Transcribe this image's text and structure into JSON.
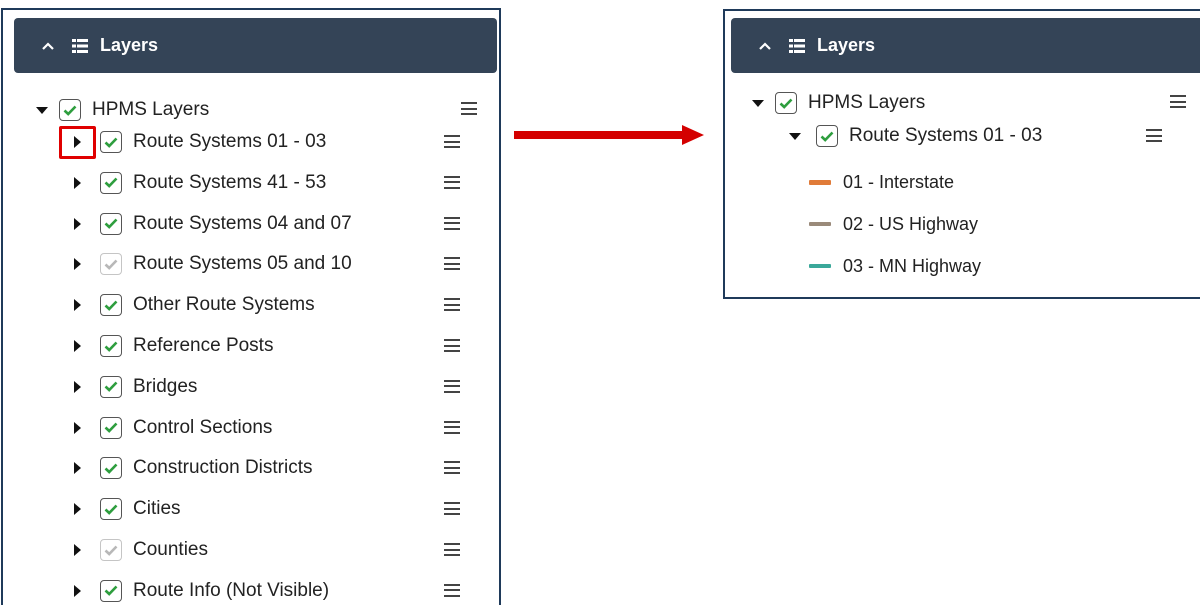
{
  "left_panel": {
    "header": {
      "title": "Layers"
    },
    "root": {
      "label": "HPMS Layers"
    },
    "items": [
      {
        "label": "Route Systems 01 - 03",
        "checked": true,
        "dim": false
      },
      {
        "label": "Route Systems 41 - 53",
        "checked": true,
        "dim": false
      },
      {
        "label": "Route Systems 04 and 07",
        "checked": true,
        "dim": false
      },
      {
        "label": "Route Systems 05 and 10",
        "checked": true,
        "dim": true
      },
      {
        "label": "Other Route Systems",
        "checked": true,
        "dim": false
      },
      {
        "label": "Reference Posts",
        "checked": true,
        "dim": false
      },
      {
        "label": "Bridges",
        "checked": true,
        "dim": false
      },
      {
        "label": "Control Sections",
        "checked": true,
        "dim": false
      },
      {
        "label": "Construction Districts",
        "checked": true,
        "dim": false
      },
      {
        "label": "Cities",
        "checked": true,
        "dim": false
      },
      {
        "label": "Counties",
        "checked": true,
        "dim": true
      },
      {
        "label": "Route Info (Not Visible)",
        "checked": true,
        "dim": false
      }
    ]
  },
  "right_panel": {
    "header": {
      "title": "Layers"
    },
    "root": {
      "label": "HPMS Layers"
    },
    "expanded_item": {
      "label": "Route Systems 01 - 03"
    },
    "legend": [
      {
        "label": "01 - Interstate",
        "color": "#e07b39"
      },
      {
        "label": "02 - US Highway",
        "color": "#9a8a7a"
      },
      {
        "label": "03 - MN Highway",
        "color": "#3aa89a"
      }
    ]
  },
  "colors": {
    "header_bg": "#344457",
    "check_green": "#2e9e3e",
    "check_dim": "#b8b8b8",
    "highlight_red": "#e00000",
    "arrow_red": "#d40000"
  }
}
